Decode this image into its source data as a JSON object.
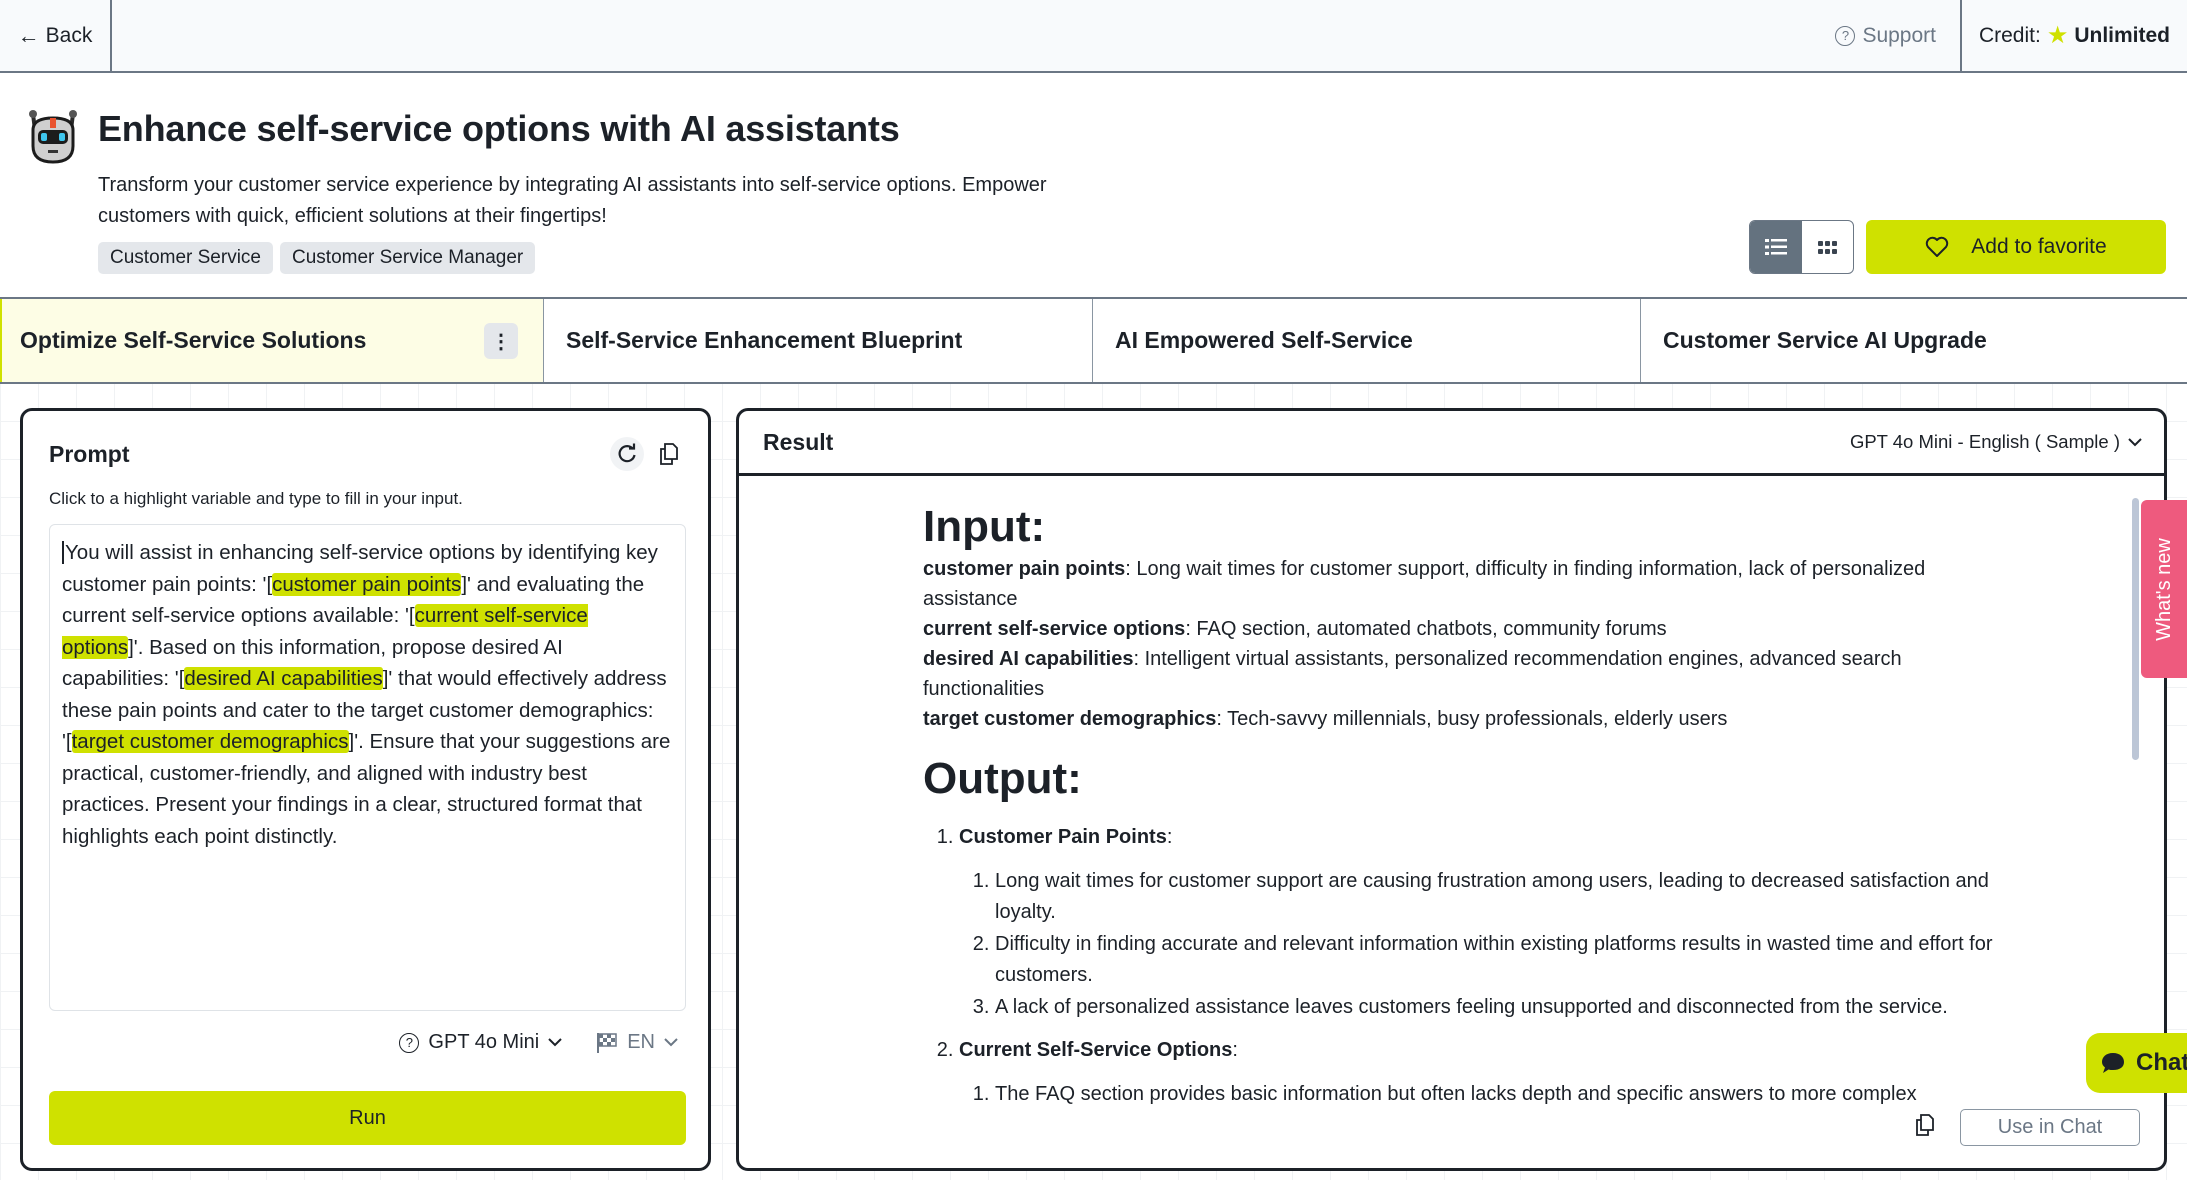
{
  "topbar": {
    "back_label": "Back",
    "support_label": "Support",
    "credit_label": "Credit:",
    "credit_value": "Unlimited"
  },
  "header": {
    "title": "Enhance self-service options with AI assistants",
    "description": "Transform your customer service experience by integrating AI assistants into self-service options. Empower customers with quick, efficient solutions at their fingertips!",
    "tags": [
      "Customer Service",
      "Customer Service Manager"
    ],
    "view_modes": [
      "list-view",
      "grid-view"
    ],
    "active_view": "list-view",
    "favorite_label": "Add to favorite"
  },
  "tabs": [
    {
      "label": "Optimize Self-Service Solutions",
      "active": true
    },
    {
      "label": "Self-Service Enhancement Blueprint",
      "active": false
    },
    {
      "label": "AI Empowered Self-Service",
      "active": false
    },
    {
      "label": "Customer Service AI Upgrade",
      "active": false
    }
  ],
  "prompt": {
    "title": "Prompt",
    "hint": "Click to a highlight variable and type to fill in your input.",
    "segments": [
      {
        "t": "You will assist in enhancing self-service options by identifying key customer pain points: '["
      },
      {
        "v": "customer pain points"
      },
      {
        "t": "]' and evaluating the current self-service options available: '["
      },
      {
        "v": "current self-service options"
      },
      {
        "t": "]'. Based on this information, propose desired AI capabilities: '["
      },
      {
        "v": "desired AI capabilities"
      },
      {
        "t": "]' that would effectively address these pain points and cater to the target customer demographics: '["
      },
      {
        "v": "target customer demographics"
      },
      {
        "t": "]'. Ensure that your suggestions are practical, customer-friendly, and aligned with industry best practices. Present your findings in a clear, structured format that highlights each point distinctly."
      }
    ],
    "model": "GPT 4o Mini",
    "language": "EN",
    "run_label": "Run"
  },
  "result": {
    "title": "Result",
    "model_selector": "GPT 4o Mini - English ( Sample )",
    "input_heading": "Input:",
    "inputs": [
      {
        "key": "customer pain points",
        "value": "Long wait times for customer support, difficulty in finding information, lack of personalized assistance"
      },
      {
        "key": "current self-service options",
        "value": "FAQ section, automated chatbots, community forums"
      },
      {
        "key": "desired AI capabilities",
        "value": "Intelligent virtual assistants, personalized recommendation engines, advanced search functionalities"
      },
      {
        "key": "target customer demographics",
        "value": "Tech-savvy millennials, busy professionals, elderly users"
      }
    ],
    "output_heading": "Output:",
    "output_sections": [
      {
        "title": "Customer Pain Points",
        "items": [
          "Long wait times for customer support are causing frustration among users, leading to decreased satisfaction and loyalty.",
          "Difficulty in finding accurate and relevant information within existing platforms results in wasted time and effort for customers.",
          "A lack of personalized assistance leaves customers feeling unsupported and disconnected from the service."
        ]
      },
      {
        "title": "Current Self-Service Options",
        "items": [
          "The FAQ section provides basic information but often lacks depth and specific answers to more complex"
        ]
      }
    ],
    "use_in_chat_label": "Use in Chat"
  },
  "floating": {
    "whats_new_label": "What's new",
    "chat_label": "Chat"
  },
  "colors": {
    "accent": "#cfe100",
    "whats_new": "#ee5a7e",
    "active_tab_bg": "#fdfde5",
    "border_dark": "#1c2128",
    "muted": "#6b7785"
  }
}
